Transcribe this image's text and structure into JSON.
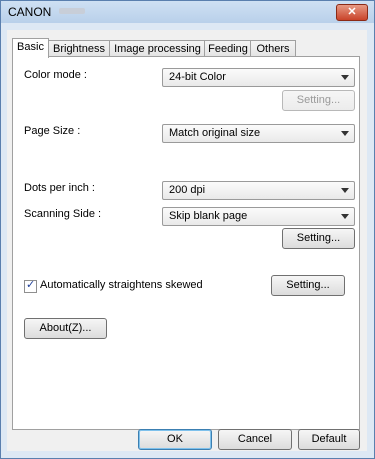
{
  "window": {
    "title": "CANON",
    "close_glyph": "✕"
  },
  "tabs": [
    {
      "label": "Basic",
      "active": true
    },
    {
      "label": "Brightness",
      "active": false
    },
    {
      "label": "Image processing",
      "active": false
    },
    {
      "label": "Feeding",
      "active": false
    },
    {
      "label": "Others",
      "active": false
    }
  ],
  "basic": {
    "color_mode": {
      "label": "Color mode :",
      "value": "24-bit Color",
      "setting_label": "Setting...",
      "setting_enabled": false
    },
    "page_size": {
      "label": "Page Size :",
      "value": "Match original size"
    },
    "dpi": {
      "label": "Dots per inch :",
      "value": "200 dpi"
    },
    "scanning_side": {
      "label": "Scanning Side :",
      "value": "Skip blank page",
      "setting_label": "Setting..."
    },
    "straighten": {
      "label": "Automatically straightens skewed",
      "checked": true,
      "check_glyph": "✓",
      "setting_label": "Setting..."
    },
    "about_label": "About(Z)..."
  },
  "footer": {
    "ok_label": "OK",
    "cancel_label": "Cancel",
    "default_label": "Default"
  }
}
